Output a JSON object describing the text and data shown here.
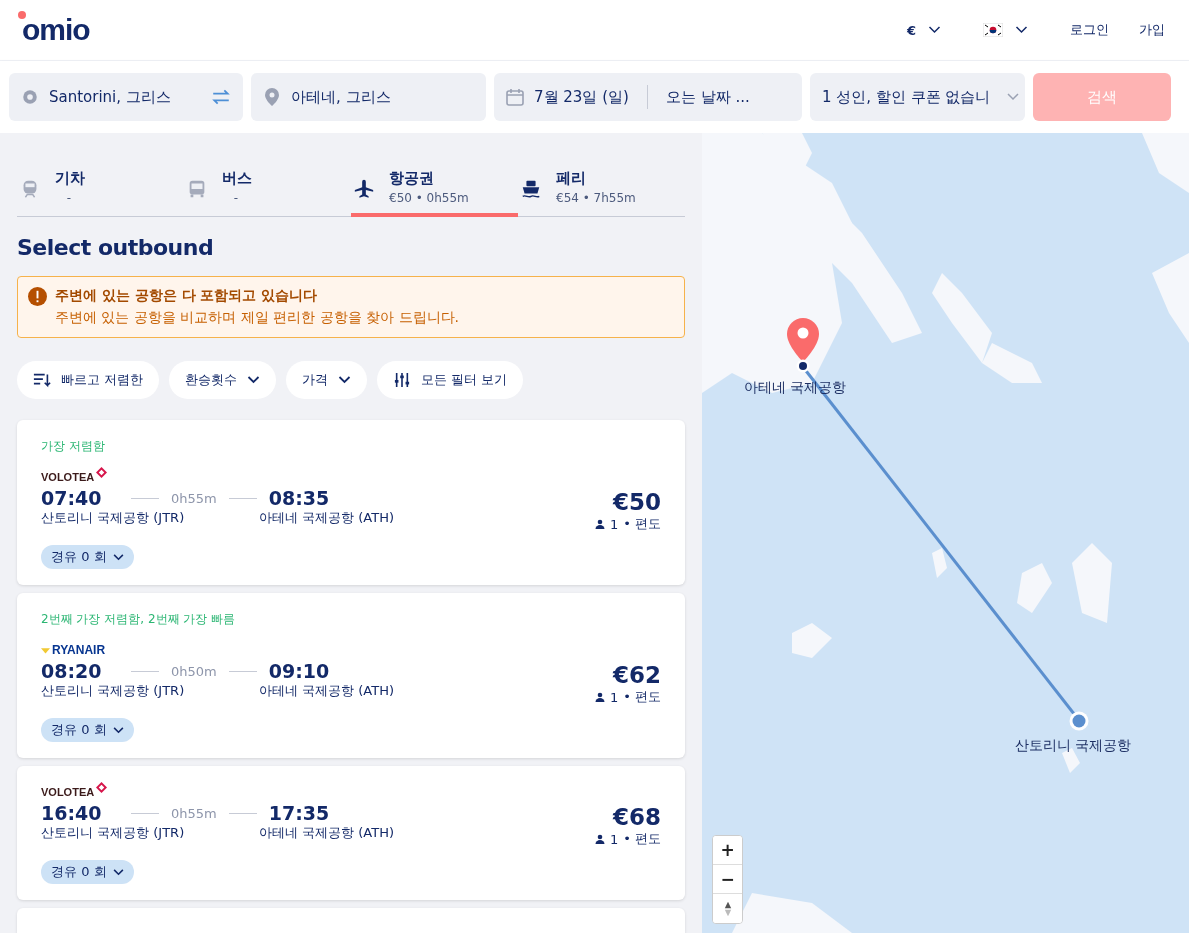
{
  "header": {
    "logo": "omio",
    "currency": "€",
    "links": [
      "로그인",
      "가입"
    ]
  },
  "search": {
    "origin": "Santorini, 그리스",
    "destination": "아테네, 그리스",
    "depart": "7월 23일 (일)",
    "return_placeholder": "오는 날짜 ...",
    "passengers": "1 성인, 할인 쿠폰 없습니",
    "button": "검색"
  },
  "tabs": [
    {
      "kind": "train",
      "label": "기차",
      "sub": "-",
      "selected": false,
      "available": false
    },
    {
      "kind": "bus",
      "label": "버스",
      "sub": "-",
      "selected": false,
      "available": false
    },
    {
      "kind": "plane",
      "label": "항공권",
      "sub": "€50 • 0h55m",
      "selected": true,
      "available": true
    },
    {
      "kind": "ferry",
      "label": "페리",
      "sub": "€54 • 7h55m",
      "selected": false,
      "available": true
    }
  ],
  "heading": "Select outbound",
  "notice": {
    "title": "주변에 있는 공항은 다 포함되고 있습니다",
    "text": "주변에 있는 공항을 비교하며 제일 편리한 공항을 찾아 드립니다."
  },
  "filters": [
    {
      "kind": "sort",
      "label": "빠르고 저렴한"
    },
    {
      "kind": "dropdown",
      "label": "환승횟수"
    },
    {
      "kind": "dropdown",
      "label": "가격"
    },
    {
      "kind": "all",
      "label": "모든 필터 보기"
    }
  ],
  "flights": [
    {
      "tag": "가장 저렴함",
      "airline": {
        "kind": "volotea",
        "name": "VOLOTEA"
      },
      "depart": "07:40",
      "duration": "0h55m",
      "arrive": "08:35",
      "from": "산토리니 국제공항 (JTR)",
      "to": "아테네 국제공항 (ATH)",
      "price": "€50",
      "pax": "1",
      "trip": "• 편도",
      "stops": "경유 0 회"
    },
    {
      "tag": "2번째 가장 저렴함,  2번째 가장 빠름",
      "airline": {
        "kind": "ryanair",
        "name": "RYANAIR"
      },
      "depart": "08:20",
      "duration": "0h50m",
      "arrive": "09:10",
      "from": "산토리니 국제공항 (JTR)",
      "to": "아테네 국제공항 (ATH)",
      "price": "€62",
      "pax": "1",
      "trip": "• 편도",
      "stops": "경유 0 회"
    },
    {
      "airline": {
        "kind": "volotea",
        "name": "VOLOTEA"
      },
      "depart": "16:40",
      "duration": "0h55m",
      "arrive": "17:35",
      "from": "산토리니 국제공항 (JTR)",
      "to": "아테네 국제공항 (ATH)",
      "price": "€68",
      "pax": "1",
      "trip": "• 편도",
      "stops": "경유 0 회"
    }
  ],
  "map": {
    "origin_label": "산토리니 국제공항",
    "destination_label": "아테네 국제공항",
    "zoom_in": "+",
    "zoom_out": "−"
  }
}
